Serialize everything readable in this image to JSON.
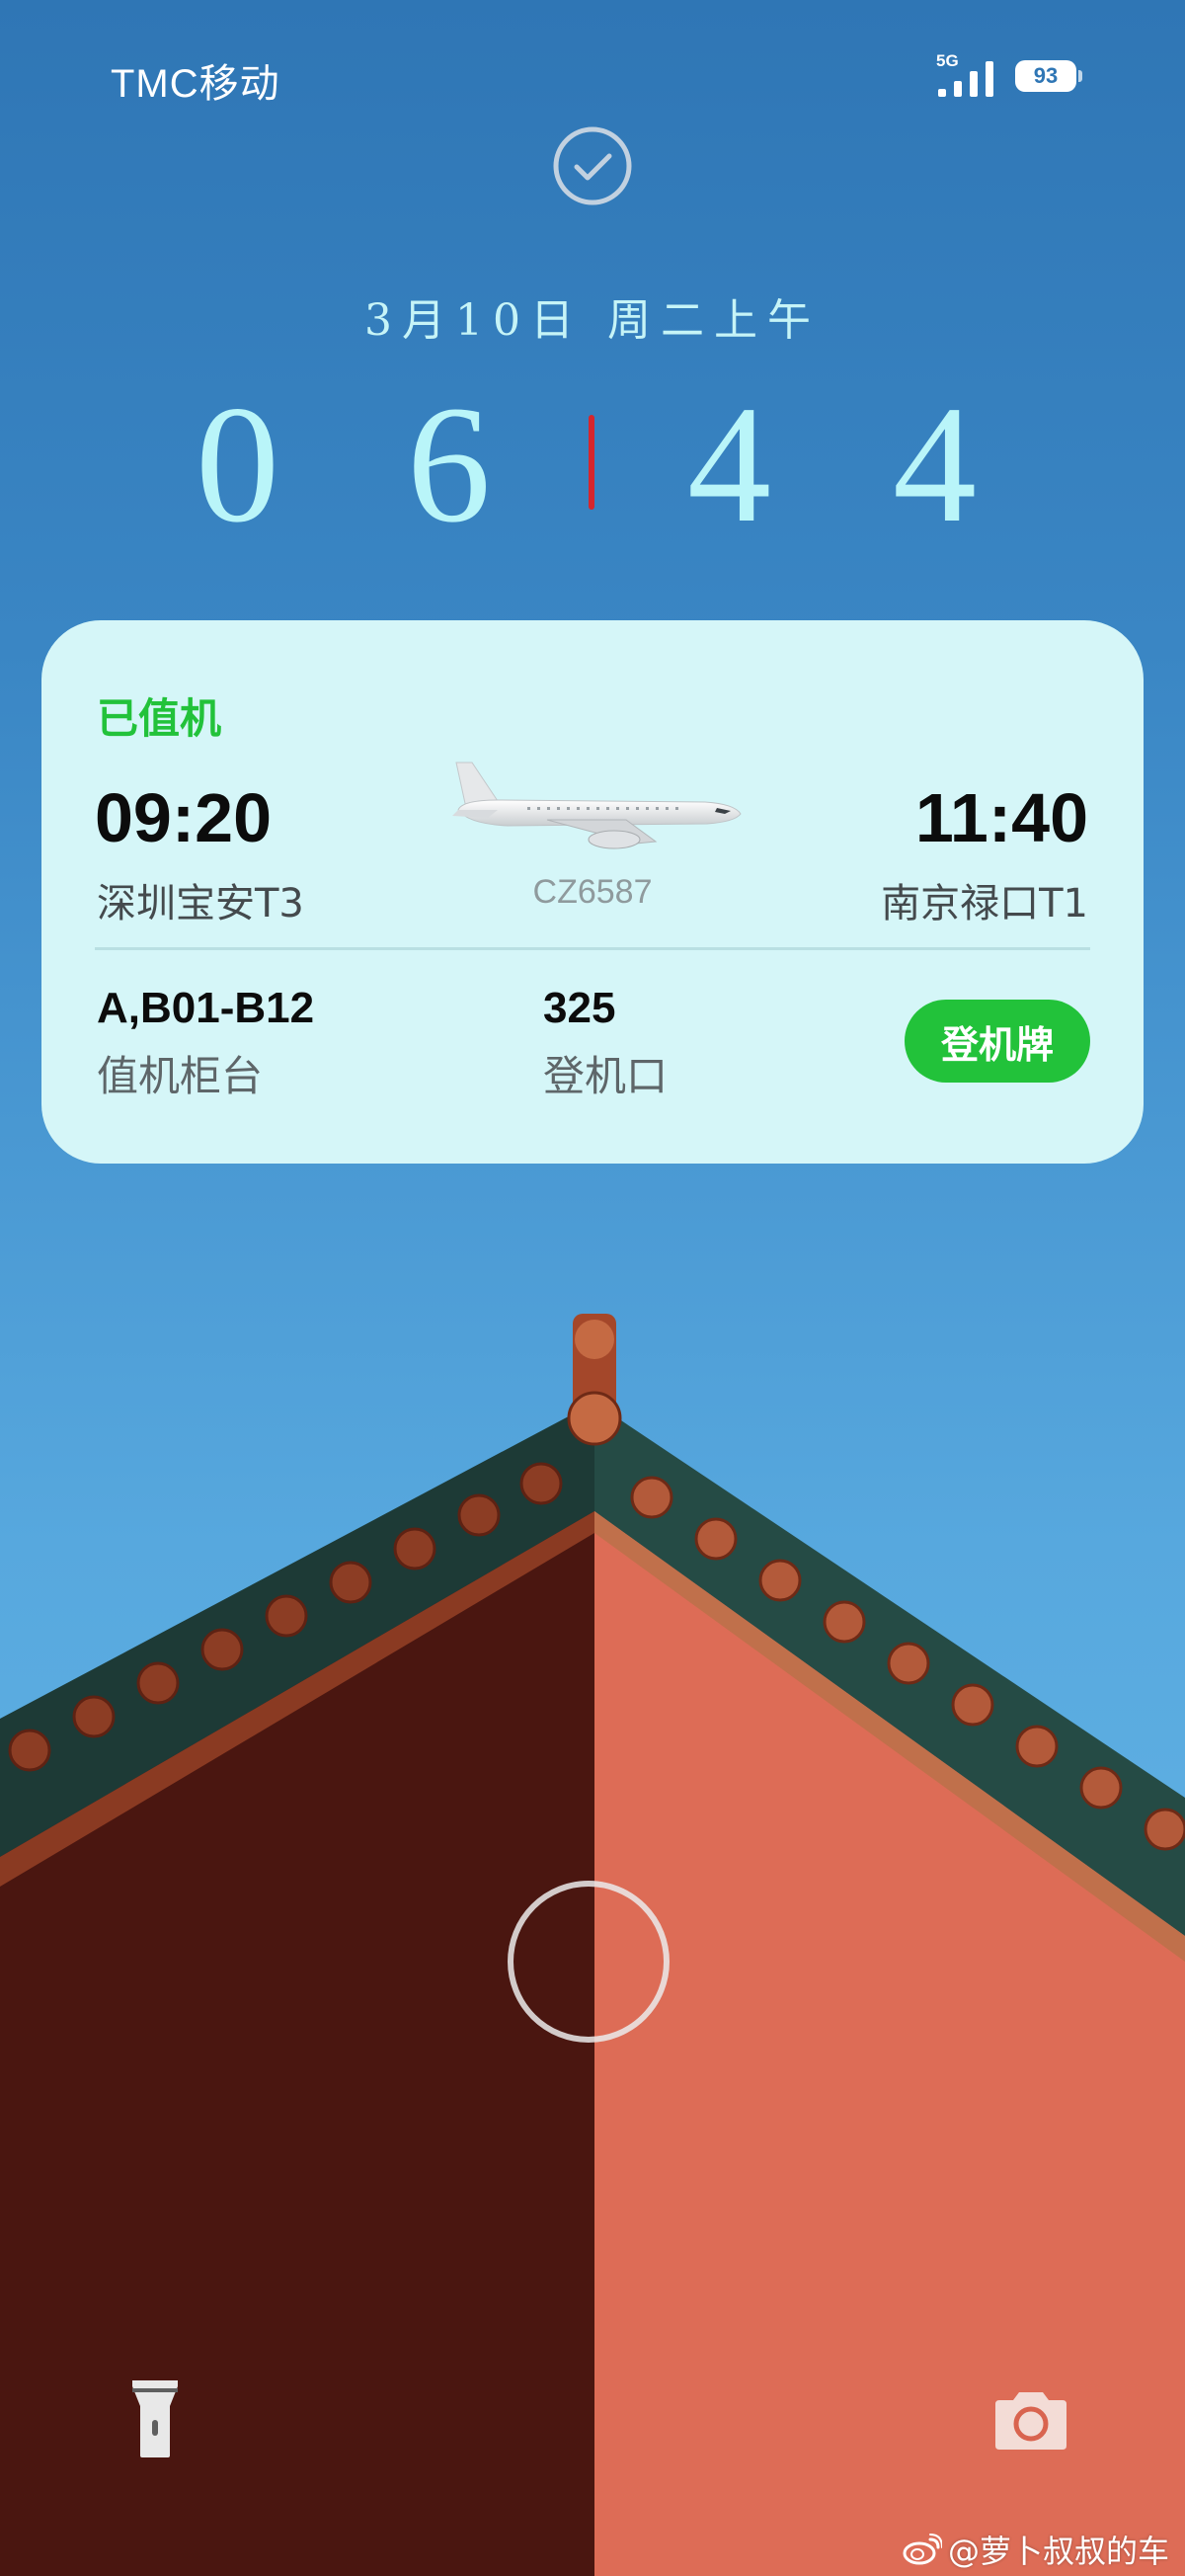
{
  "status_bar": {
    "carrier": "TMC移动",
    "network": "5G",
    "battery": "93"
  },
  "lockscreen": {
    "date": "3月10日 周二上午",
    "clock": {
      "d1": "0",
      "d2": "6",
      "d3": "4",
      "d4": "4"
    }
  },
  "flight_card": {
    "status": "已值机",
    "departure": {
      "time": "09:20",
      "airport": "深圳宝安T3"
    },
    "arrival": {
      "time": "11:40",
      "airport": "南京禄口T1"
    },
    "flight_number": "CZ6587",
    "counter": {
      "value": "A,B01-B12",
      "label": "值机柜台"
    },
    "gate": {
      "value": "325",
      "label": "登机口"
    },
    "boarding_pass_button": "登机牌"
  },
  "shortcuts": {
    "left": "flashlight-icon",
    "right": "camera-icon"
  },
  "watermark": "@萝卜叔叔的车",
  "colors": {
    "sky_top": "#2f76b5",
    "sky_bottom": "#5fb0e3",
    "card_bg": "#d5f6f8",
    "accent_green": "#22c23a",
    "clock_digits": "#b9f5f9",
    "clock_separator": "#d6262d",
    "wall_left": "#4a1610",
    "wall_right": "#d9644f"
  }
}
